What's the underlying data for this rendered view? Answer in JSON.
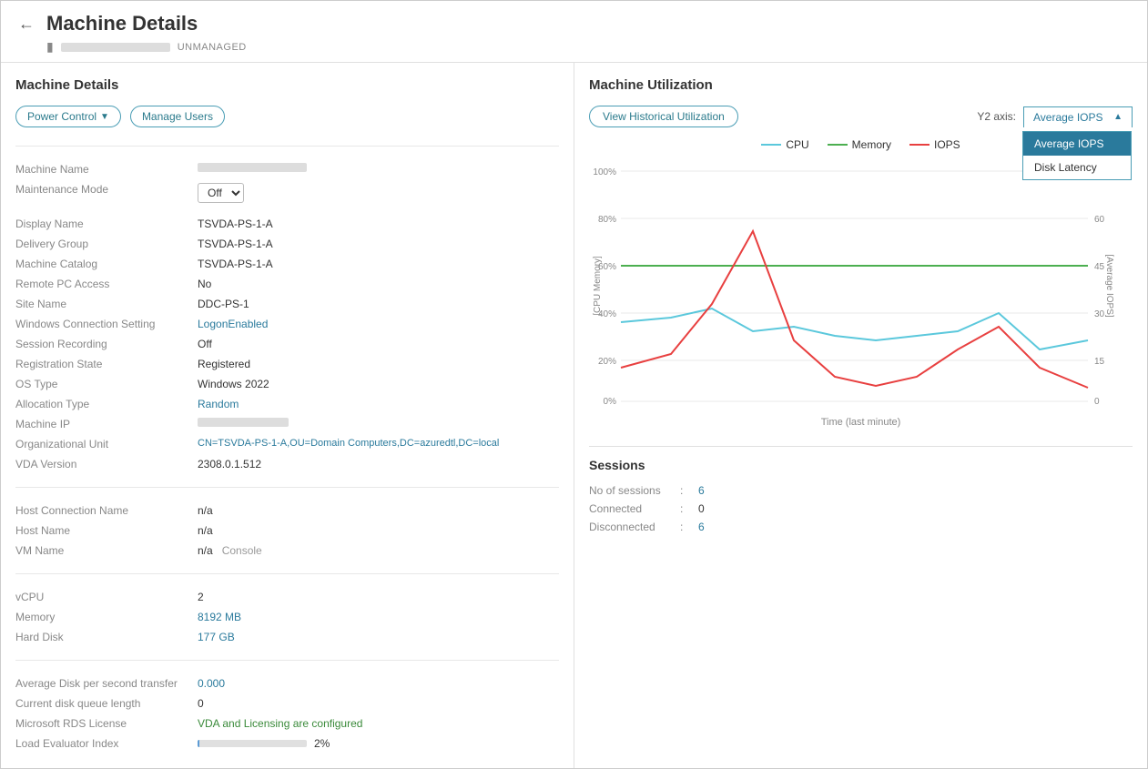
{
  "header": {
    "title": "Machine Details",
    "machine_name_placeholder": "REDACTED",
    "unmanaged": "UNMANAGED"
  },
  "left_panel": {
    "title": "Machine Details",
    "buttons": {
      "power_control": "Power Control",
      "manage_users": "Manage Users"
    },
    "fields": {
      "machine_name_label": "Machine Name",
      "maintenance_mode_label": "Maintenance Mode",
      "maintenance_mode_value": "Off",
      "display_name_label": "Display Name",
      "display_name_value": "TSVDA-PS-1-A",
      "delivery_group_label": "Delivery Group",
      "delivery_group_value": "TSVDA-PS-1-A",
      "machine_catalog_label": "Machine Catalog",
      "machine_catalog_value": "TSVDA-PS-1-A",
      "remote_pc_label": "Remote PC Access",
      "remote_pc_value": "No",
      "site_name_label": "Site Name",
      "site_name_value": "DDC-PS-1",
      "windows_connection_label": "Windows Connection Setting",
      "windows_connection_value": "LogonEnabled",
      "session_recording_label": "Session Recording",
      "session_recording_value": "Off",
      "registration_state_label": "Registration State",
      "registration_state_value": "Registered",
      "os_type_label": "OS Type",
      "os_type_value": "Windows 2022",
      "allocation_type_label": "Allocation Type",
      "allocation_type_value": "Random",
      "machine_ip_label": "Machine IP",
      "org_unit_label": "Organizational Unit",
      "org_unit_value": "CN=TSVDA-PS-1-A,OU=Domain Computers,DC=azuredtl,DC=local",
      "vda_version_label": "VDA Version",
      "vda_version_value": "2308.0.1.512",
      "host_connection_label": "Host Connection Name",
      "host_connection_value": "n/a",
      "host_name_label": "Host Name",
      "host_name_value": "n/a",
      "vm_name_label": "VM Name",
      "vm_name_value": "n/a",
      "console_link": "Console",
      "vcpu_label": "vCPU",
      "vcpu_value": "2",
      "memory_label": "Memory",
      "memory_value": "8192 MB",
      "hard_disk_label": "Hard Disk",
      "hard_disk_value": "177 GB",
      "avg_disk_label": "Average Disk per second transfer",
      "avg_disk_value": "0.000",
      "disk_queue_label": "Current disk queue length",
      "disk_queue_value": "0",
      "rds_license_label": "Microsoft RDS License",
      "rds_license_value": "VDA and Licensing are configured",
      "load_eval_label": "Load Evaluator Index",
      "load_eval_percent": "2%",
      "load_eval_bar_fill_width": "2"
    }
  },
  "right_panel": {
    "title": "Machine Utilization",
    "view_hist_btn": "View Historical Utilization",
    "y2_axis_label": "Y2 axis:",
    "y2_selected": "Average IOPS",
    "y2_options": [
      "Average IOPS",
      "Disk Latency"
    ],
    "legend": {
      "cpu": "CPU",
      "memory": "Memory",
      "iops": "IOPS"
    },
    "chart_time_label": "Time (last minute)",
    "sessions": {
      "title": "Sessions",
      "no_of_sessions_label": "No of sessions",
      "no_of_sessions_value": "6",
      "connected_label": "Connected",
      "connected_value": "0",
      "disconnected_label": "Disconnected",
      "disconnected_value": "6"
    }
  },
  "colors": {
    "accent": "#2a7a9c",
    "cpu": "#5bc8dc",
    "memory": "#4caf50",
    "iops": "#e84040",
    "grid": "#e8e8e8",
    "axis_text": "#888888"
  }
}
